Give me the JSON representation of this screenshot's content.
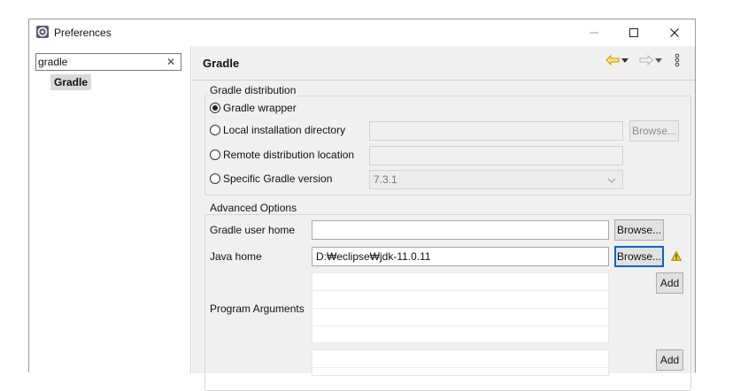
{
  "window": {
    "title": "Preferences",
    "minimize_icon": "minimize-icon",
    "maximize_icon": "maximize-icon",
    "close_icon": "close-icon"
  },
  "filter": {
    "value": "gradle"
  },
  "tree": {
    "items": [
      {
        "label": "Gradle",
        "selected": true
      }
    ]
  },
  "page": {
    "title": "Gradle",
    "toolbar": {
      "back_icon": "back-arrow-icon",
      "forward_icon": "forward-arrow-icon",
      "menu_icon": "view-menu-icon"
    }
  },
  "distribution": {
    "group_label": "Gradle distribution",
    "options": [
      {
        "label": "Gradle wrapper",
        "checked": true
      },
      {
        "label": "Local installation directory",
        "checked": false
      },
      {
        "label": "Remote distribution location",
        "checked": false
      },
      {
        "label": "Specific Gradle version",
        "checked": false
      }
    ],
    "browse_label": "Browse...",
    "version_value": "7.3.1"
  },
  "advanced": {
    "group_label": "Advanced Options",
    "user_home_label": "Gradle user home",
    "user_home_value": "",
    "java_home_label": "Java home",
    "java_home_value": "D:₩eclipse₩jdk-11.0.11",
    "browse_label": "Browse...",
    "program_args_label": "Program Arguments",
    "add_label": "Add",
    "warning_icon": "warning-icon"
  }
}
